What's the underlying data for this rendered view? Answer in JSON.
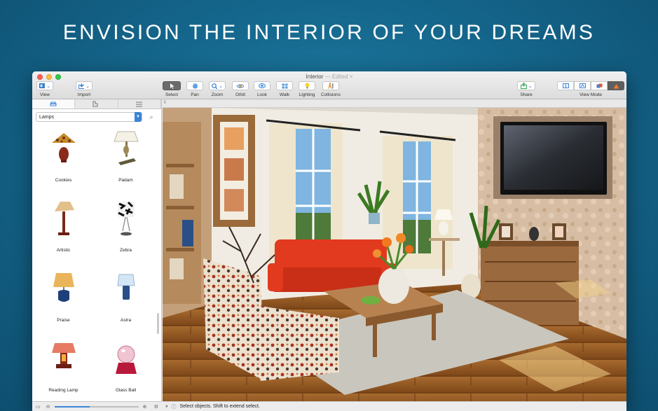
{
  "headline": "ENVISION THE INTERIOR OF YOUR DREAMS",
  "window": {
    "title": "Interior",
    "edited": "— Edited ˅"
  },
  "toolbar": {
    "left": [
      {
        "label": "View",
        "icon": "view-icon"
      },
      {
        "label": "Import",
        "icon": "import-icon"
      }
    ],
    "tools": [
      {
        "label": "Select",
        "icon": "cursor-icon",
        "active": true
      },
      {
        "label": "Pan",
        "icon": "hand-icon"
      },
      {
        "label": "Zoom",
        "icon": "zoom-icon"
      },
      {
        "label": "Orbit",
        "icon": "orbit-icon"
      },
      {
        "label": "Look",
        "icon": "eye-icon"
      },
      {
        "label": "Walk",
        "icon": "walk-icon"
      },
      {
        "label": "Lighting",
        "icon": "bulb-icon"
      },
      {
        "label": "Collisions",
        "icon": "collision-icon"
      }
    ],
    "share": "Share",
    "view_mode": "View Mode"
  },
  "sidebar": {
    "category": "Lamps",
    "items": [
      {
        "label": "Cookies"
      },
      {
        "label": "Padam"
      },
      {
        "label": "Artistic"
      },
      {
        "label": "Zebra"
      },
      {
        "label": "Praise"
      },
      {
        "label": "Astra"
      },
      {
        "label": "Reading Lamp"
      },
      {
        "label": "Glass Ball"
      }
    ],
    "zoom_level": 0.42
  },
  "status": {
    "text": "Select objects. Shift to extend select."
  },
  "colors": {
    "accent": "#3a84d8",
    "background": "#15678d",
    "sofa": "#e23a1e"
  }
}
